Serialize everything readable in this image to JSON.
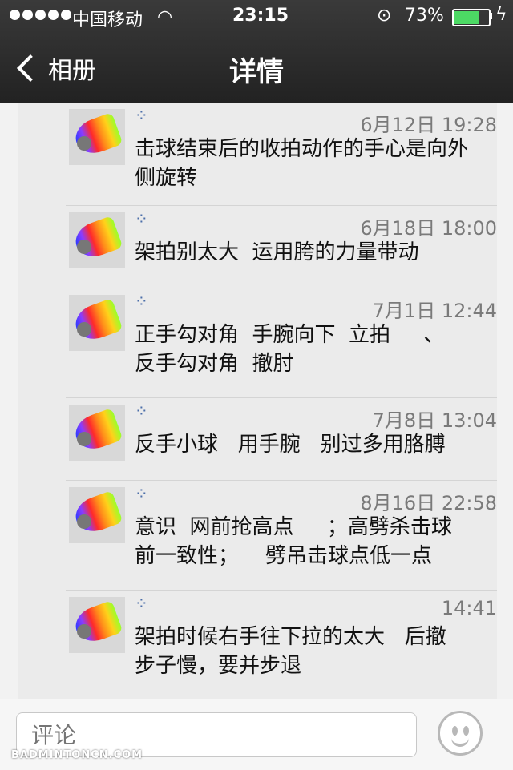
{
  "status": {
    "carrier": "中国移动",
    "time": "23:15",
    "battery_percent": "73%",
    "battery_level": 0.73
  },
  "nav": {
    "back_label": "相册",
    "title": "详情"
  },
  "entries": [
    {
      "date": "6月12日 19:28",
      "text": "击球结束后的收拍动作的手心是向外侧旋转"
    },
    {
      "date": "6月18日 18:00",
      "text": "架拍别太大  运用胯的力量带动"
    },
    {
      "date": "7月1日 12:44",
      "text": "正手勾对角  手腕向下  立拍     、\n反手勾对角  撤肘"
    },
    {
      "date": "7月8日 13:04",
      "text": "反手小球   用手腕   别过多用胳膊"
    },
    {
      "date": "8月16日 22:58",
      "text": "意识  网前抢高点     ；高劈杀击球\n前一致性；    劈吊击球点低一点"
    },
    {
      "date": "14:41",
      "text": "架拍时候右手往下拉的太大   后撤\n步子慢，要并步退"
    }
  ],
  "comment": {
    "placeholder": "评论"
  },
  "watermark": "BADMINTONCN.COM",
  "colors": {
    "battery_green": "#4cd964",
    "link_icon": "#4b6ea9"
  },
  "icons": {
    "entry_icon": "sparkle-icon",
    "emoji": "smiley-icon"
  }
}
